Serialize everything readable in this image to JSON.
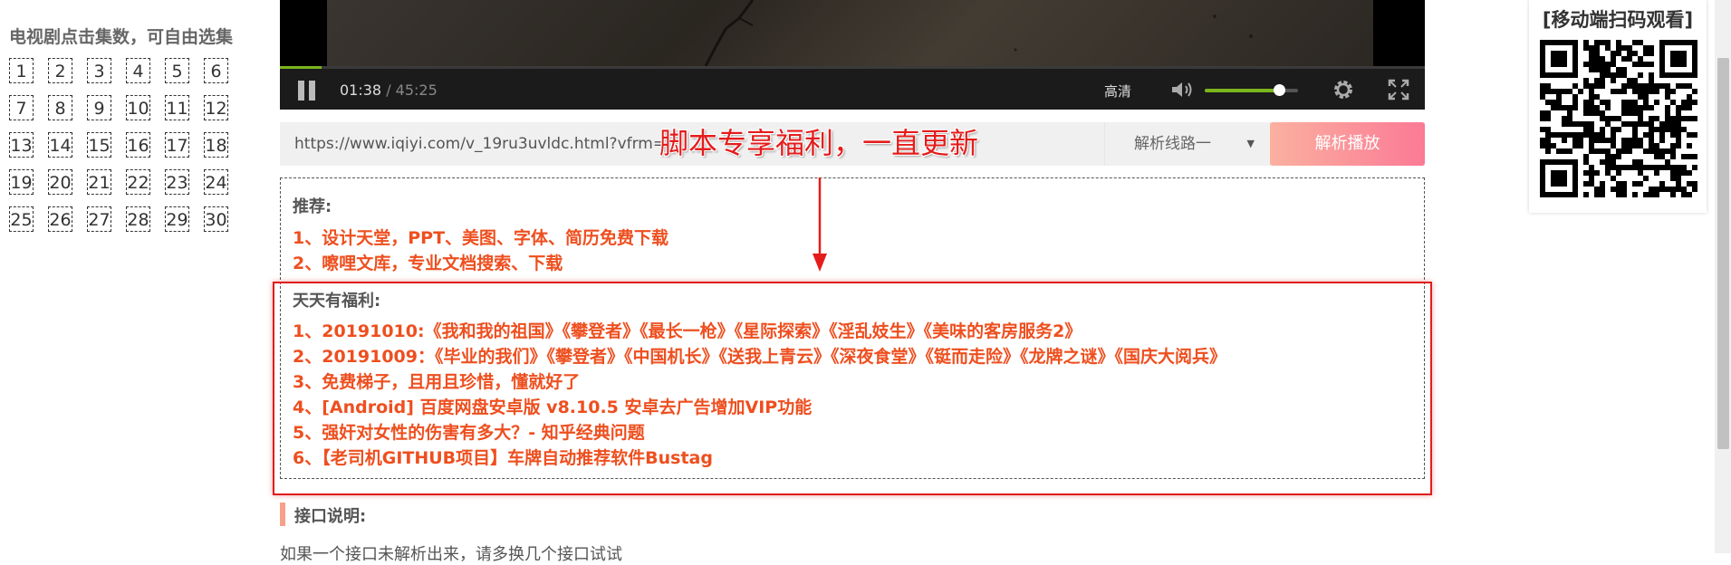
{
  "episodes": {
    "title": "电视剧点击集数，可自由选集",
    "items": [
      "1",
      "2",
      "3",
      "4",
      "5",
      "6",
      "7",
      "8",
      "9",
      "10",
      "11",
      "12",
      "13",
      "14",
      "15",
      "16",
      "17",
      "18",
      "19",
      "20",
      "21",
      "22",
      "23",
      "24",
      "25",
      "26",
      "27",
      "28",
      "29",
      "30"
    ]
  },
  "player": {
    "current_time": "01:38",
    "duration": "/ 45:25",
    "quality": "高清",
    "progress": 0.036,
    "volume": 0.8,
    "progress_color": "#7ab51d"
  },
  "parse": {
    "url": "https://www.iqiyi.com/v_19ru3uvldc.html?vfrm=",
    "line_label": "解析线路一",
    "play_label": "解析播放"
  },
  "annotation": {
    "text": "脚本专享福利，一直更新",
    "color": "#e41c1c"
  },
  "recommend": {
    "title": "推荐:",
    "items": [
      "1、设计天堂，PPT、美图、字体、简历免费下载",
      "2、嚓哩文库，专业文档搜索、下载"
    ]
  },
  "welfare": {
    "title": "天天有福利:",
    "items": [
      "1、20191010:《我和我的祖国》《攀登者》《最长一枪》《星际探索》《淫乱妓生》《美味的客房服务2》",
      "2、20191009：《毕业的我们》《攀登者》《中国机长》《送我上青云》《深夜食堂》《铤而走险》《龙牌之谜》《国庆大阅兵》",
      "3、免费梯子，且用且珍惜，懂就好了",
      "4、[Android] 百度网盘安卓版 v8.10.5 安卓去广告增加VIP功能",
      "5、强奸对女性的伤害有多大？- 知乎经典问题",
      "6、【老司机GITHUB项目】车牌自动推荐软件Bustag"
    ]
  },
  "interface": {
    "title": "接口说明:",
    "desc": "如果一个接口未解析出来，请多换几个接口试试"
  },
  "qr": {
    "title": "[移动端扫码观看]"
  }
}
